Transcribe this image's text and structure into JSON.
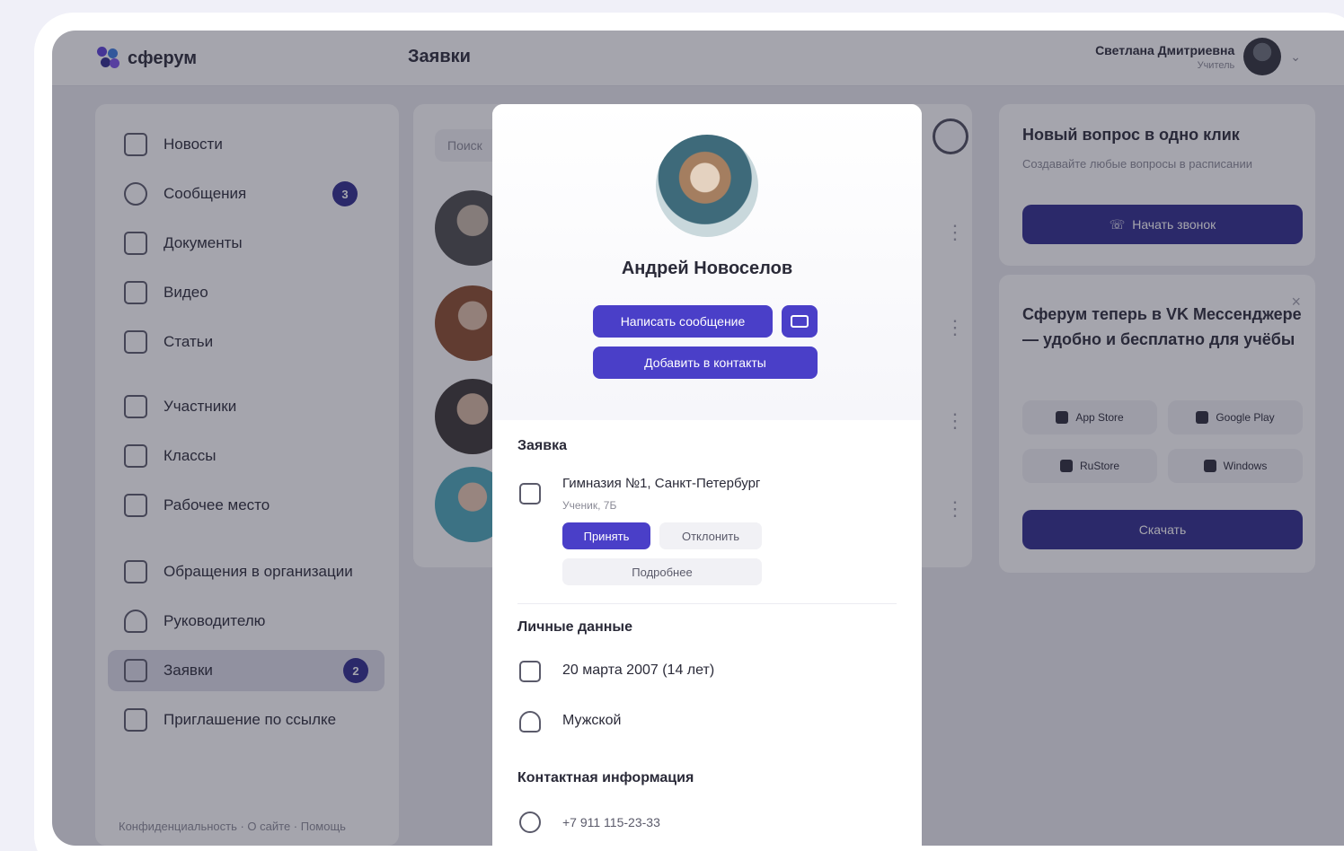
{
  "app": {
    "logo_text": "сферум",
    "page_title": "Заявки"
  },
  "user": {
    "name": "Светлана Дмитриевна",
    "role": "Учитель"
  },
  "sidebar": {
    "items": [
      {
        "label": "Новости"
      },
      {
        "label": "Сообщения",
        "badge": "3"
      },
      {
        "label": "Документы"
      },
      {
        "label": "Видео"
      },
      {
        "label": "Статьи"
      },
      {
        "label": "Участники"
      },
      {
        "label": "Классы"
      },
      {
        "label": "Рабочее место"
      },
      {
        "label": "Обращения в организации"
      },
      {
        "label": "Руководителю"
      },
      {
        "label": "Заявки",
        "badge": "2"
      },
      {
        "label": "Приглашение по ссылке"
      }
    ],
    "footer": "Конфиденциальность · О сайте · Помощь"
  },
  "list": {
    "search_placeholder": "Поиск"
  },
  "promo1": {
    "title": "Новый вопрос в одно клик",
    "subtitle": "Создавайте любые вопросы в расписании",
    "button": "Начать звонок"
  },
  "promo2": {
    "title": "Сферум теперь в VK Мессенджере — удобно и бесплатно для учёбы",
    "store_buttons": [
      "App Store",
      "Google Play",
      "RuStore",
      "Windows"
    ],
    "button": "Скачать"
  },
  "modal": {
    "name": "Андрей Новоселов",
    "write_button": "Написать сообщение",
    "add_button": "Добавить в контакты",
    "request_section": "Заявка",
    "school": "Гимназия №1, Санкт-Петербург",
    "school_sub": "Ученик, 7Б",
    "accept_chip": "Принять",
    "reject_chip": "Отклонить",
    "more_chip": "Подробнее",
    "personal_section": "Личные данные",
    "birthday": "20 марта 2007 (14 лет)",
    "gender": "Мужской",
    "contact_section": "Контактная информация",
    "phone": "+7 911 115-23-33"
  },
  "colors": {
    "accent": "#4a3fc8",
    "dark_accent": "#2e2a8c"
  }
}
